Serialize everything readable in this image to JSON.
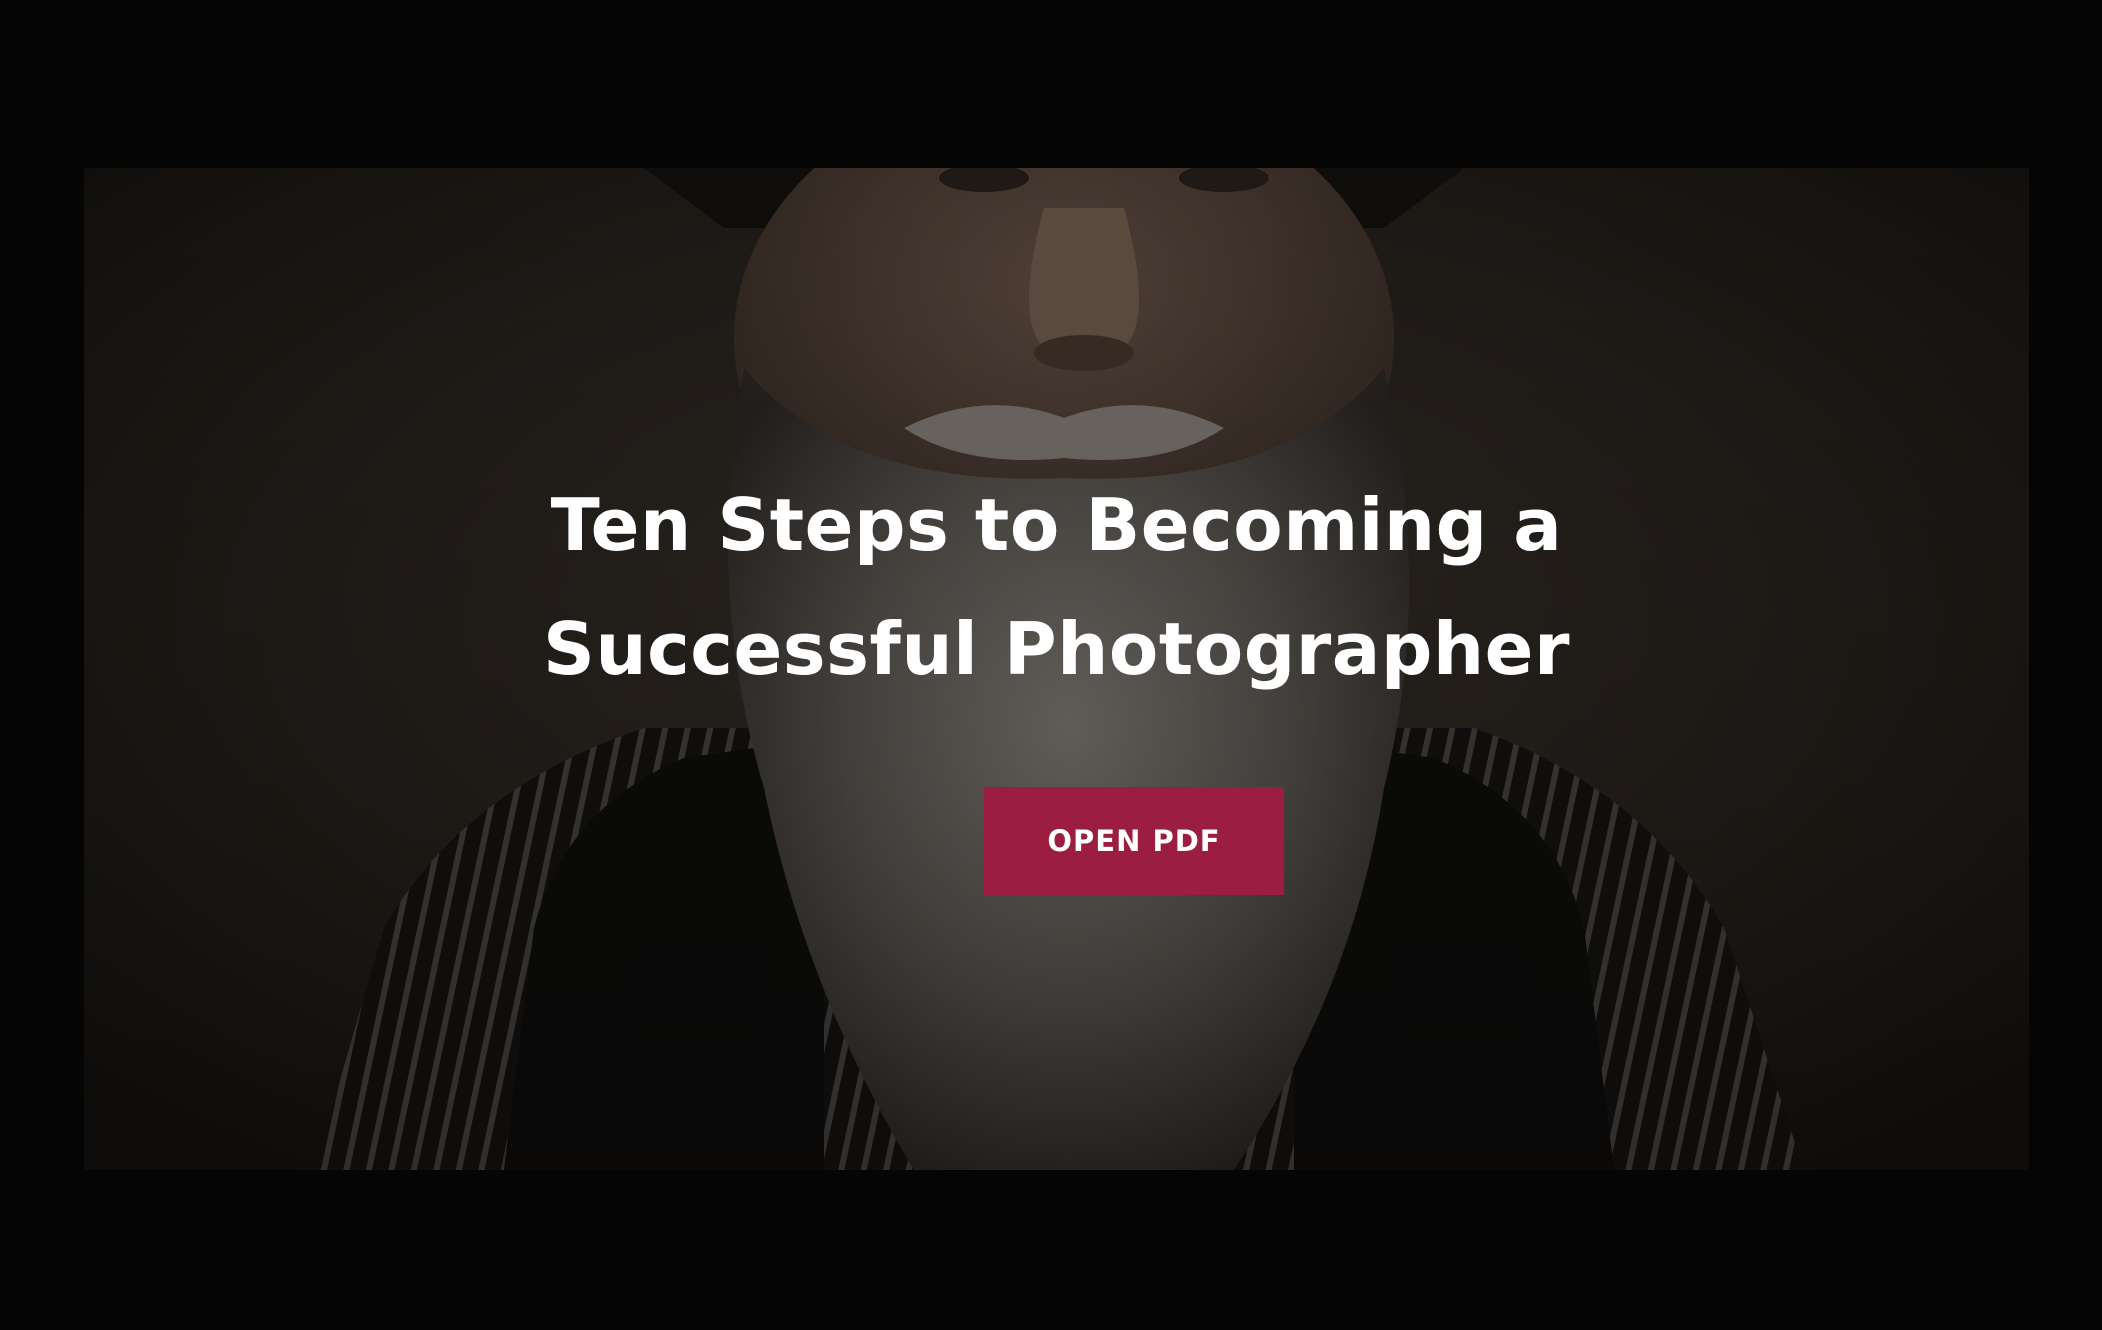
{
  "hero": {
    "title_line1": "Ten Steps to Becoming a",
    "title_line2": "Successful Photographer",
    "background_image": "bearded-man-portrait",
    "button_label": "OPEN PDF"
  },
  "colors": {
    "page_background": "#050505",
    "button_background": "#9b1d40",
    "title_text": "#ffffff"
  }
}
